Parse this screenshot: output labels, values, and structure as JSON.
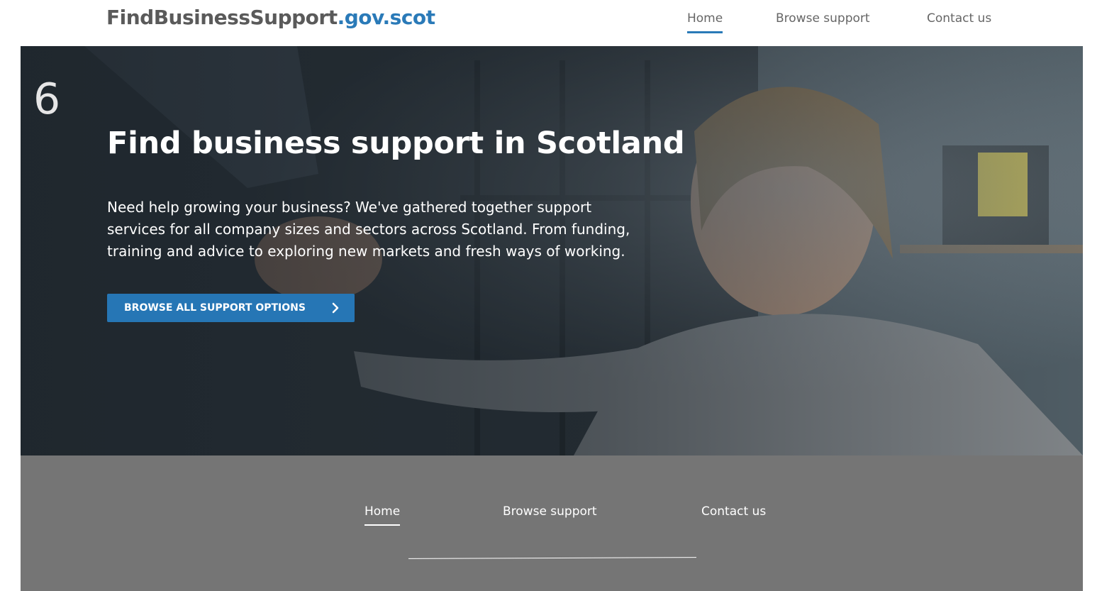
{
  "header": {
    "logo_main": "FindBusinessSupport",
    "logo_suffix": ".gov.scot",
    "nav": [
      {
        "label": "Home",
        "active": true
      },
      {
        "label": "Browse support",
        "active": false
      },
      {
        "label": "Contact us",
        "active": false
      }
    ]
  },
  "hero": {
    "title": "Find business support in Scotland",
    "lead": "Need help growing your business? We've gathered together support services for all company sizes and sectors across Scotland. From funding, training and advice to exploring new markets and fresh ways of working.",
    "cta_label": "BROWSE ALL SUPPORT OPTIONS",
    "cta_icon": "chevron-right-icon"
  },
  "footer": {
    "nav": [
      {
        "label": "Home",
        "active": true
      },
      {
        "label": "Browse support",
        "active": false
      },
      {
        "label": "Contact us",
        "active": false
      }
    ]
  },
  "colors": {
    "brand_blue": "#2a7ab8",
    "button_blue": "#2676b5",
    "logo_grey": "#5a5a5a",
    "footer_grey": "#757575"
  }
}
